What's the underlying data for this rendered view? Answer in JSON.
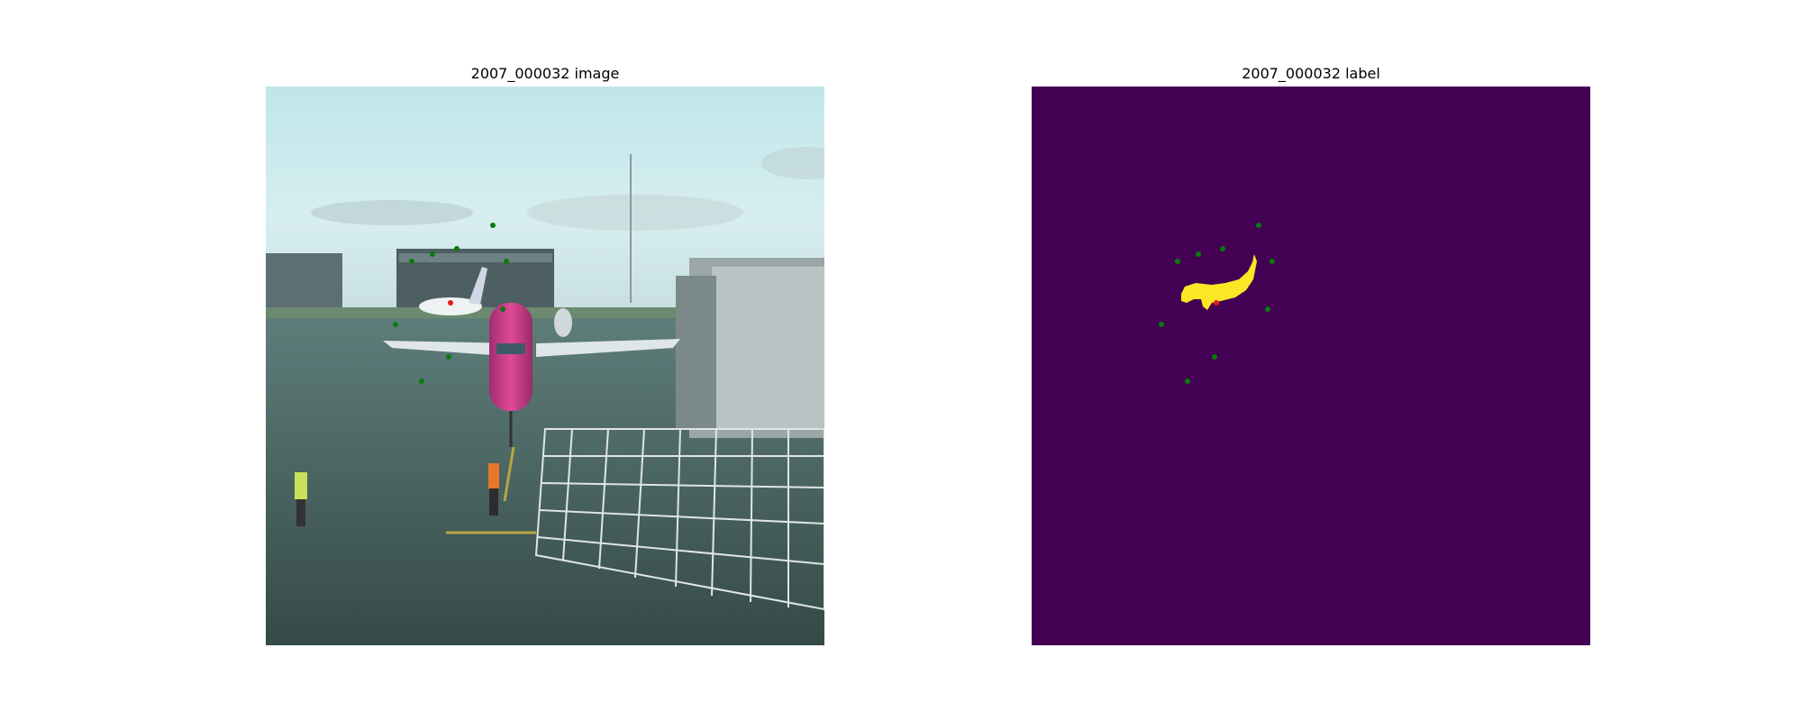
{
  "panels": {
    "left_title": "2007_000032 image",
    "right_title": "2007_000032 label"
  },
  "colors": {
    "background_class": "#440154",
    "foreground_class": "#fde725",
    "positive_point": "#e8191b",
    "negative_point": "#0a7a0a"
  }
}
